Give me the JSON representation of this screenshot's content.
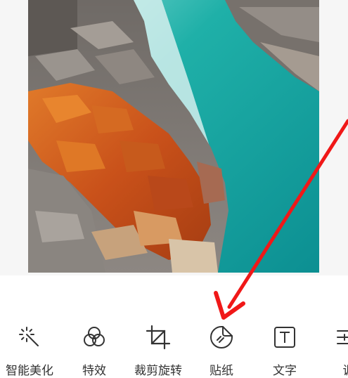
{
  "toolbar": {
    "tools": [
      {
        "label": "智能美化",
        "icon": "magic-wand-icon"
      },
      {
        "label": "特效",
        "icon": "effects-circles-icon"
      },
      {
        "label": "裁剪旋转",
        "icon": "crop-rotate-icon"
      },
      {
        "label": "贴纸",
        "icon": "sticker-icon"
      },
      {
        "label": "文字",
        "icon": "text-box-icon"
      },
      {
        "label": "调",
        "icon": "adjust-sliders-icon"
      }
    ]
  },
  "colors": {
    "annotation_arrow": "#f01818",
    "icon_stroke": "#333333",
    "water": "#1aa9a3",
    "rock_orange": "#d8661c",
    "basalt": "#8a8580"
  }
}
